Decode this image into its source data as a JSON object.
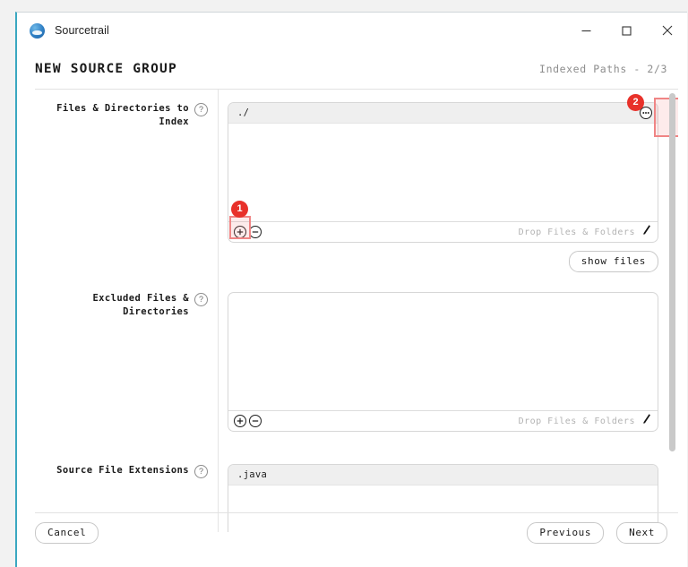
{
  "window": {
    "app_title": "Sourcetrail",
    "app_icon": "sourcetrail-logo-icon",
    "controls": {
      "minimize": "minimize-icon",
      "maximize": "maximize-icon",
      "close": "close-icon"
    }
  },
  "header": {
    "title": "NEW SOURCE GROUP",
    "step": "Indexed Paths - 2/3"
  },
  "form": {
    "rows": [
      {
        "label_line1": "Files & Directories to",
        "label_line2": "Index",
        "help": "?",
        "items": [
          "./"
        ],
        "drop_hint": "Drop Files & Folders",
        "add_label": "+",
        "remove_label": "−"
      },
      {
        "label_line1": "Excluded Files &",
        "label_line2": "Directories",
        "help": "?",
        "items": [],
        "drop_hint": "Drop Files & Folders",
        "add_label": "+",
        "remove_label": "−"
      },
      {
        "label_line1": "Source File Extensions",
        "label_line2": "",
        "help": "?",
        "items": [
          ".java"
        ],
        "drop_hint": "",
        "add_label": "+",
        "remove_label": "−"
      }
    ],
    "show_files_label": "show files"
  },
  "annotations": {
    "badge1": "1",
    "badge2": "2"
  },
  "footer": {
    "cancel_label": "Cancel",
    "previous_label": "Previous",
    "next_label": "Next"
  },
  "colors": {
    "accent": "#3aa8c1",
    "annotation": "#e8312a",
    "annotation_box": "#f08585"
  }
}
